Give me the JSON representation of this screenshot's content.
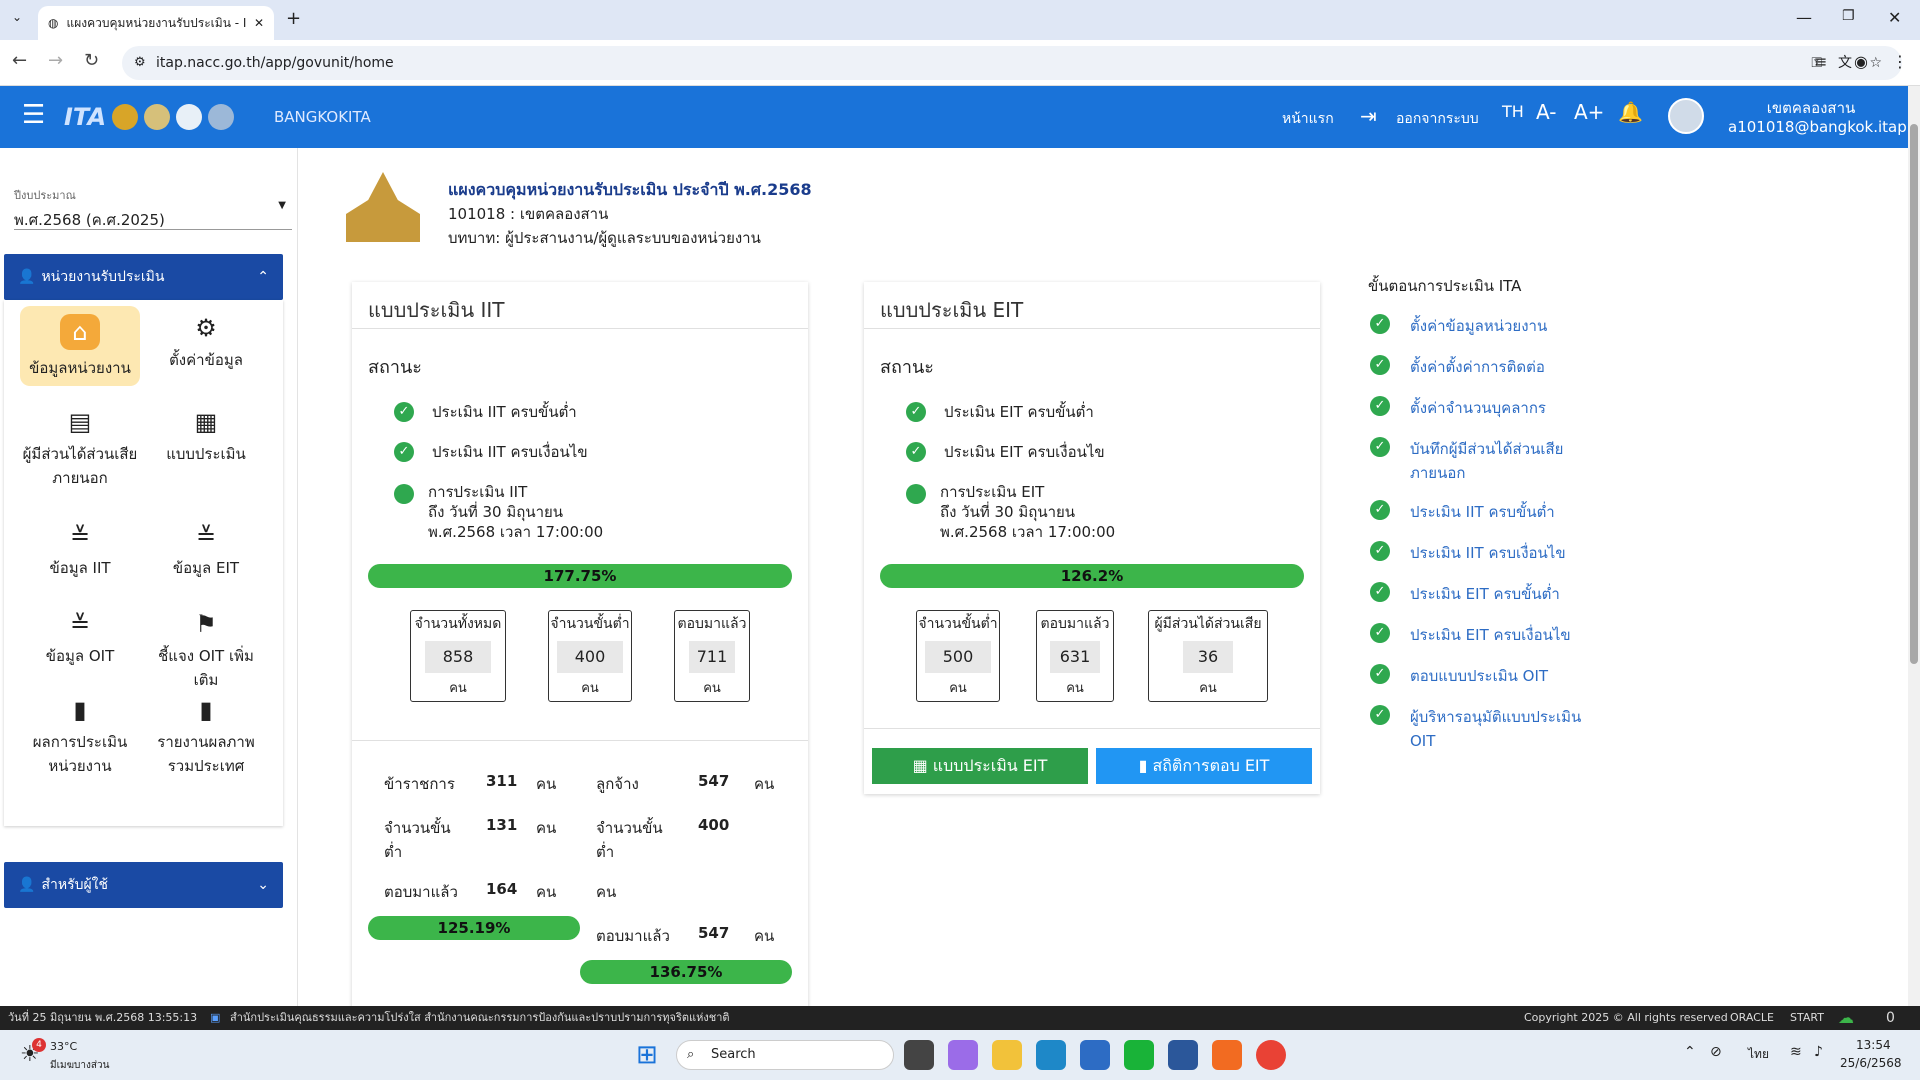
{
  "browser": {
    "tab_title": "แผงควบคุมหน่วยงานรับประเมิน - ITA",
    "url": "itap.nacc.go.th/app/govunit/home"
  },
  "header": {
    "site_name": "BANGKOKITA",
    "home_label": "หน้าแรก",
    "logout_label": "ออกจากระบบ",
    "lang_label": "TH",
    "font_minus": "A-",
    "font_plus": "A+",
    "user_name": "เขตคลองสาน",
    "user_email": "a101018@bangkok.itap"
  },
  "sidebar": {
    "fiscal_label": "ปีงบประมาณ",
    "fiscal_value": "พ.ศ.2568 (ค.ศ.2025)",
    "section1": "หน่วยงานรับประเมิน",
    "section2": "สำหรับผู้ใช้",
    "items": [
      {
        "label": "ข้อมูลหน่วยงาน",
        "icon": "home-icon"
      },
      {
        "label": "ตั้งค่าข้อมูล",
        "icon": "settings-icon"
      },
      {
        "label": "ผู้มีส่วนได้ส่วนเสียภายนอก",
        "icon": "store-icon"
      },
      {
        "label": "แบบประเมิน",
        "icon": "qr-icon"
      },
      {
        "label": "ข้อมูล IIT",
        "icon": "checklist-icon"
      },
      {
        "label": "ข้อมูล EIT",
        "icon": "checklist-icon"
      },
      {
        "label": "ข้อมูล OIT",
        "icon": "checklist-icon"
      },
      {
        "label": "ชี้แจง OIT เพิ่มเติม",
        "icon": "flag-icon"
      },
      {
        "label": "ผลการประเมินหน่วยงาน",
        "icon": "chart-icon"
      },
      {
        "label": "รายงานผลภาพรวมประเทศ",
        "icon": "chart-icon"
      }
    ]
  },
  "unit": {
    "title": "แผงควบคุมหน่วยงานรับประเมิน ประจำปี พ.ศ.2568",
    "code_name": "101018 : เขตคลองสาน",
    "role": "บทบาท: ผู้ประสานงาน/ผู้ดูแลระบบของหน่วยงาน"
  },
  "iit": {
    "title": "แบบประเมิน IIT",
    "status_label": "สถานะ",
    "status1": "ประเมิน IIT ครบขั้นต่ำ",
    "status2": "ประเมิน IIT ครบเงื่อนไข",
    "status3_l1": "การประเมิน IIT",
    "status3_l2": "ถึง วันที่ 30 มิถุนายน",
    "status3_l3": "พ.ศ.2568 เวลา 17:00:00",
    "progress_text": "177.75%",
    "progress": 1.0,
    "stats": [
      {
        "label": "จำนวนทั้งหมด",
        "value": "858",
        "unit": "คน"
      },
      {
        "label": "จำนวนขั้นต่ำ",
        "value": "400",
        "unit": "คน"
      },
      {
        "label": "ตอบมาแล้ว",
        "value": "711",
        "unit": "คน"
      }
    ],
    "gov_label": "ข้าราชการ",
    "gov_value": "311",
    "emp_label": "ลูกจ้าง",
    "emp_value": "547",
    "unit": "คน",
    "min_label": "จำนวนขั้นต่ำ",
    "gov_min": "131",
    "emp_min": "400",
    "answered_label": "ตอบมาแล้ว",
    "gov_answered": "164",
    "emp_answered": "547",
    "gov_progress": "125.19%",
    "emp_progress": "136.75%"
  },
  "eit": {
    "title": "แบบประเมิน EIT",
    "status_label": "สถานะ",
    "status1": "ประเมิน EIT ครบขั้นต่ำ",
    "status2": "ประเมิน EIT ครบเงื่อนไข",
    "status3_l1": "การประเมิน EIT",
    "status3_l2": "ถึง วันที่ 30 มิถุนายน",
    "status3_l3": "พ.ศ.2568 เวลา 17:00:00",
    "progress_text": "126.2%",
    "progress": 1.0,
    "stats": [
      {
        "label": "จำนวนขั้นต่ำ",
        "value": "500",
        "unit": "คน"
      },
      {
        "label": "ตอบมาแล้ว",
        "value": "631",
        "unit": "คน"
      },
      {
        "label": "ผู้มีส่วนได้ส่วนเสีย",
        "value": "36",
        "unit": "คน"
      }
    ],
    "btn_form": "แบบประเมิน EIT",
    "btn_stats": "สถิติการตอบ EIT"
  },
  "steps": {
    "title": "ขั้นตอนการประเมิน ITA",
    "items": [
      "ตั้งค่าข้อมูลหน่วยงาน",
      "ตั้งค่าตั้งค่าการติดต่อ",
      "ตั้งค่าจำนวนบุคลากร",
      "บันทึกผู้มีส่วนได้ส่วนเสียภายนอก",
      "ประเมิน IIT ครบขั้นต่ำ",
      "ประเมิน IIT ครบเงื่อนไข",
      "ประเมิน EIT ครบขั้นต่ำ",
      "ประเมิน EIT ครบเงื่อนไข",
      "ตอบแบบประเมิน OIT",
      "ผู้บริหารอนุมัติแบบประเมิน OIT"
    ]
  },
  "statusbar": {
    "left": "วันที่ 25 มิถุนายน พ.ศ.2568 13:55:13",
    "office": "สำนักประเมินคุณธรรมและความโปร่งใส สำนักงานคณะกรรมการป้องกันและปราบปรามการทุจริตแห่งชาติ",
    "copyright": "Copyright 2025 © All rights reserved",
    "oracle": "ORACLE",
    "start": "START",
    "count": "0"
  },
  "taskbar": {
    "temp": "33°C",
    "weather": "มีเมฆบางส่วน",
    "badge": "4",
    "search": "Search",
    "lang": "ไทย",
    "time": "13:54",
    "date": "25/6/2568"
  },
  "colors": {
    "header": "#1a73d9",
    "section": "#1a4aa4",
    "progress": "#3cb54a",
    "check": "#2fa84f",
    "button_green": "#2e9e4a",
    "button_blue": "#2196f3"
  }
}
